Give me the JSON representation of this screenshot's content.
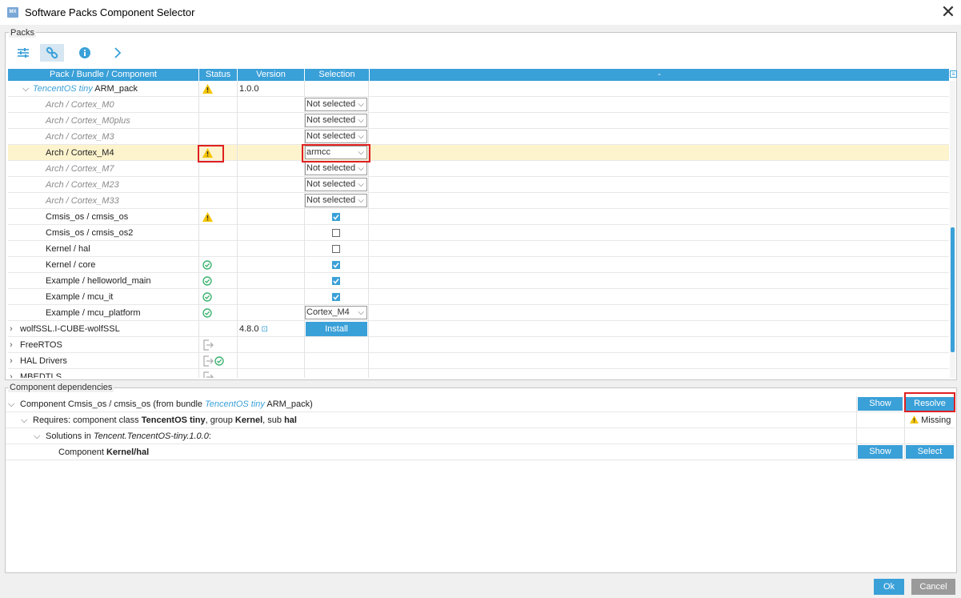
{
  "window": {
    "title": "Software Packs Component Selector",
    "app_icon_text": "MX"
  },
  "packs": {
    "group_label": "Packs",
    "toolbar": [
      "filter-icon",
      "link-icon",
      "info-icon",
      "chevron-right-icon"
    ],
    "headers": {
      "name": "Pack / Bundle / Component",
      "status": "Status",
      "version": "Version",
      "selection": "Selection",
      "extra": "-"
    },
    "rows": [
      {
        "name_italic": "TencentOS tiny",
        "name": " ARM_pack",
        "status": "warning",
        "version": "1.0.0",
        "expanded": true
      },
      {
        "name": "Arch / Cortex_M0",
        "selection": "Not selected"
      },
      {
        "name": "Arch / Cortex_M0plus",
        "selection": "Not selected"
      },
      {
        "name": "Arch / Cortex_M3",
        "selection": "Not selected"
      },
      {
        "name": "Arch / Cortex_M4",
        "status": "warning",
        "selection": "armcc"
      },
      {
        "name": "Arch / Cortex_M7",
        "selection": "Not selected"
      },
      {
        "name": "Arch / Cortex_M23",
        "selection": "Not selected"
      },
      {
        "name": "Arch / Cortex_M33",
        "selection": "Not selected"
      },
      {
        "name": "Cmsis_os / cmsis_os",
        "status": "warning",
        "checked": true
      },
      {
        "name": "Cmsis_os / cmsis_os2",
        "checked": false
      },
      {
        "name": "Kernel / hal",
        "checked": false
      },
      {
        "name": "Kernel / core",
        "status": "ok",
        "checked": true
      },
      {
        "name": "Example / helloworld_main",
        "status": "ok",
        "checked": true
      },
      {
        "name": "Example / mcu_it",
        "status": "ok",
        "checked": true
      },
      {
        "name": "Example / mcu_platform",
        "status": "ok",
        "selection": "Cortex_M4"
      },
      {
        "name": "wolfSSL.I-CUBE-wolfSSL",
        "version": "4.8.0",
        "action": "Install"
      },
      {
        "name": "FreeRTOS",
        "status": "export"
      },
      {
        "name": "HAL Drivers",
        "status": "export-ok"
      },
      {
        "name": "MBEDTLS",
        "status": "export"
      }
    ]
  },
  "dependencies": {
    "group_label": "Component dependencies",
    "row1": {
      "prefix": "Component Cmsis_os / cmsis_os (from bundle ",
      "bundle": "TencentOS tiny",
      "suffix": " ARM_pack)"
    },
    "row2": {
      "p1": "Requires: component class ",
      "b1": "TencentOS tiny",
      "p2": ", group ",
      "b2": "Kernel",
      "p3": ", sub ",
      "b3": "hal",
      "status": "Missing"
    },
    "row3": {
      "p1": "Solutions in ",
      "i1": "Tencent.TencentOS-tiny.1.0.0",
      "p2": ":"
    },
    "row4": {
      "p1": "Component ",
      "b1": "Kernel/hal"
    },
    "show_label": "Show",
    "resolve_label": "Resolve",
    "select_label": "Select"
  },
  "footer": {
    "ok": "Ok",
    "cancel": "Cancel"
  }
}
